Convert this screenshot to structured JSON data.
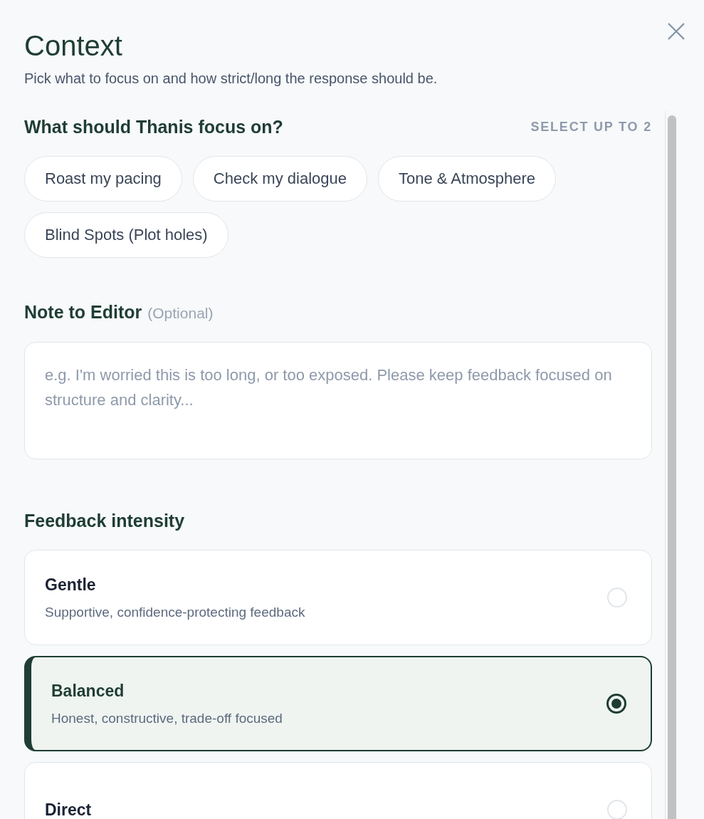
{
  "title": "Context",
  "subtitle": "Pick what to focus on and how strict/long the response should be.",
  "focus": {
    "heading": "What should Thanis focus on?",
    "limit": "SELECT UP TO 2",
    "chips": [
      {
        "label": "Roast my pacing",
        "selected": false
      },
      {
        "label": "Check my dialogue",
        "selected": false
      },
      {
        "label": "Tone & Atmosphere",
        "selected": false
      },
      {
        "label": "Blind Spots (Plot holes)",
        "selected": false
      }
    ]
  },
  "note": {
    "heading": "Note to Editor",
    "optional": "(Optional)",
    "placeholder": "e.g. I'm worried this is too long, or too exposed. Please keep feedback focused on structure and clarity..."
  },
  "intensity": {
    "heading": "Feedback intensity",
    "options": [
      {
        "title": "Gentle",
        "description": "Supportive, confidence-protecting feedback",
        "selected": false
      },
      {
        "title": "Balanced",
        "description": "Honest, constructive, trade-off focused",
        "selected": true
      },
      {
        "title": "Direct",
        "selected": false
      }
    ]
  }
}
